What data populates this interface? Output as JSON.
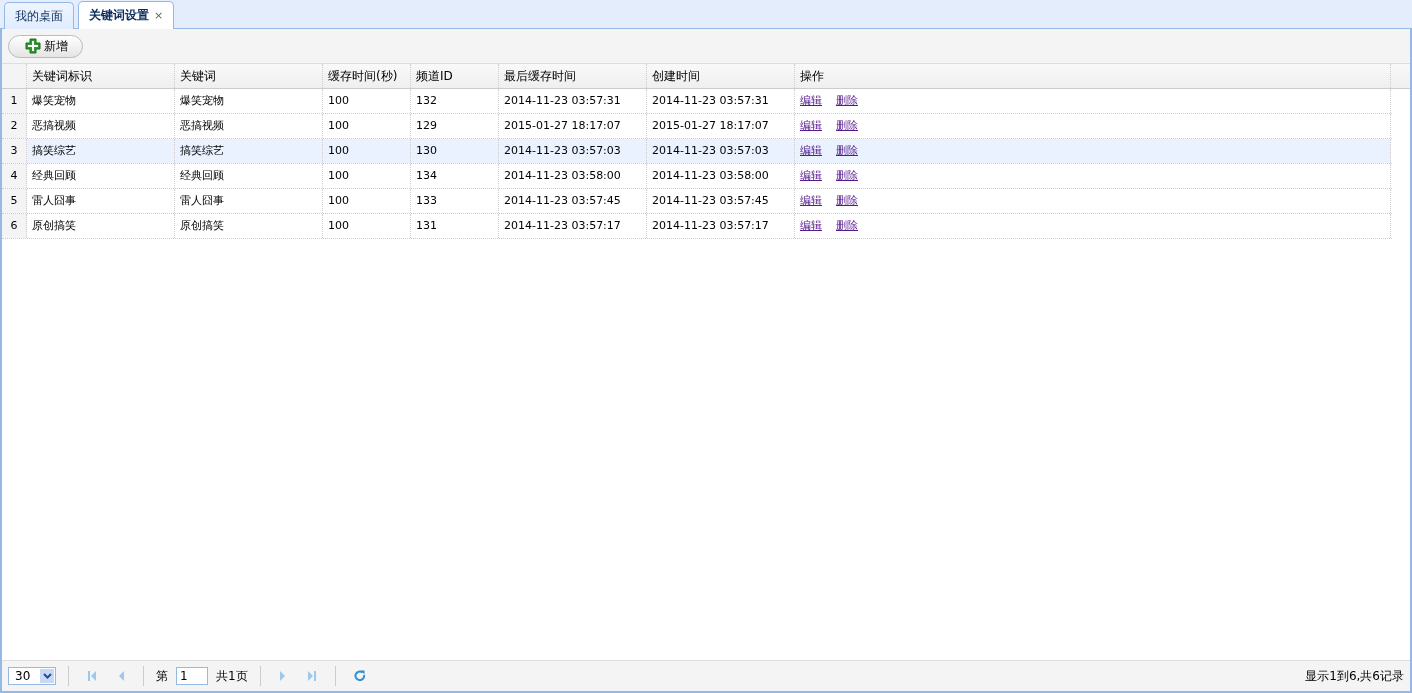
{
  "tabs": [
    {
      "label": "我的桌面",
      "selected": false
    },
    {
      "label": "关键词设置",
      "selected": true,
      "close": "×"
    }
  ],
  "toolbar": {
    "add_button": "新增"
  },
  "table": {
    "columns": [
      "关键词标识",
      "关键词",
      "缓存时间(秒)",
      "频道ID",
      "最后缓存时间",
      "创建时间",
      "操作"
    ],
    "rows": [
      {
        "index": "1",
        "cells": [
          "爆笑宠物",
          "爆笑宠物",
          "100",
          "132",
          "2014-11-23 03:57:31",
          "2014-11-23 03:57:31"
        ],
        "actions": [
          "编辑",
          "删除"
        ],
        "selected": false
      },
      {
        "index": "2",
        "cells": [
          "恶搞视频",
          "恶搞视频",
          "100",
          "129",
          "2015-01-27 18:17:07",
          "2015-01-27 18:17:07"
        ],
        "actions": [
          "编辑",
          "删除"
        ],
        "selected": false
      },
      {
        "index": "3",
        "cells": [
          "搞笑综艺",
          "搞笑综艺",
          "100",
          "130",
          "2014-11-23 03:57:03",
          "2014-11-23 03:57:03"
        ],
        "actions": [
          "编辑",
          "删除"
        ],
        "selected": true
      },
      {
        "index": "4",
        "cells": [
          "经典回顾",
          "经典回顾",
          "100",
          "134",
          "2014-11-23 03:58:00",
          "2014-11-23 03:58:00"
        ],
        "actions": [
          "编辑",
          "删除"
        ],
        "selected": false
      },
      {
        "index": "5",
        "cells": [
          "雷人囧事",
          "雷人囧事",
          "100",
          "133",
          "2014-11-23 03:57:45",
          "2014-11-23 03:57:45"
        ],
        "actions": [
          "编辑",
          "删除"
        ],
        "selected": false
      },
      {
        "index": "6",
        "cells": [
          "原创搞笑",
          "原创搞笑",
          "100",
          "131",
          "2014-11-23 03:57:17",
          "2014-11-23 03:57:17"
        ],
        "actions": [
          "编辑",
          "删除"
        ],
        "selected": false
      }
    ]
  },
  "pager": {
    "page_size": "30",
    "page_prefix": "第",
    "page_value": "1",
    "page_total": "共1页",
    "summary": "显示1到6,共6记录"
  }
}
